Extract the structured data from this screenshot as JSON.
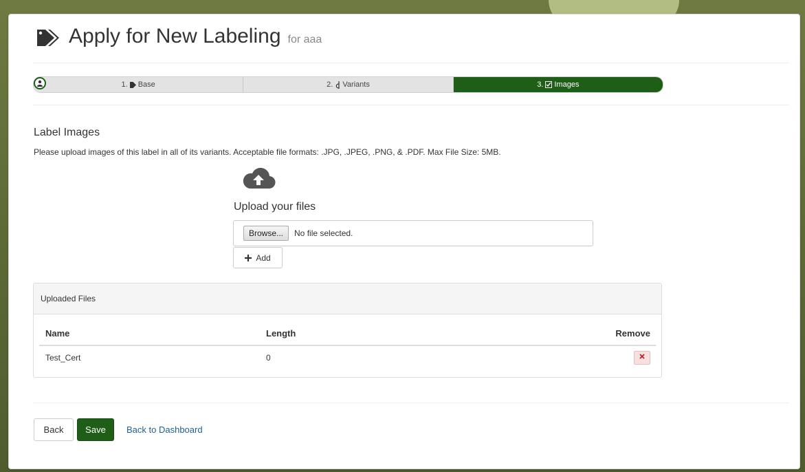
{
  "header": {
    "title": "Apply for New Labeling",
    "subtitle": "for aaa"
  },
  "wizard": {
    "steps": [
      {
        "number": "1.",
        "label": "Base",
        "icon": "tag-icon",
        "active": false
      },
      {
        "number": "2.",
        "label": "Variants",
        "icon": "variants-icon",
        "active": false
      },
      {
        "number": "3.",
        "label": "Images",
        "icon": "check-square-icon",
        "active": true
      }
    ]
  },
  "label_images": {
    "title": "Label Images",
    "help": "Please upload images of this label in all of its variants. Acceptable file formats: .JPG, .JPEG, .PNG, & .PDF. Max File Size: 5MB."
  },
  "upload": {
    "title": "Upload your files",
    "browse_label": "Browse...",
    "no_file_text": "No file selected.",
    "add_label": "Add"
  },
  "uploaded_files": {
    "title": "Uploaded Files",
    "columns": [
      "Name",
      "Length",
      "Remove"
    ],
    "rows": [
      {
        "name": "Test_Cert",
        "length": "0"
      }
    ]
  },
  "footer": {
    "back_label": "Back",
    "save_label": "Save",
    "dashboard_label": "Back to Dashboard"
  },
  "colors": {
    "accent": "#1e5e17",
    "link": "#1f5f8b",
    "remove": "#b22222"
  }
}
